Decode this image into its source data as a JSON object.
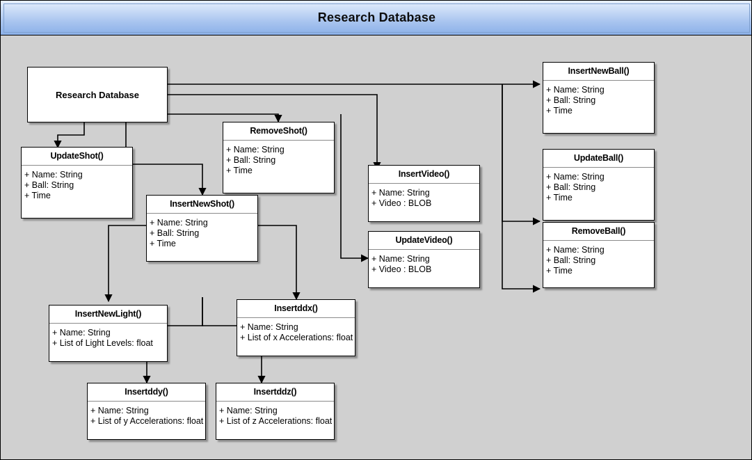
{
  "window": {
    "title": "Research Database"
  },
  "colors": {
    "background": "#d0d0d0",
    "titlebar_top": "#e8f0fc",
    "titlebar_bottom": "#8bb0e8",
    "box_fill": "#ffffff",
    "line": "#000000"
  },
  "diagram": {
    "root": {
      "label": "Research Database"
    },
    "nodes": [
      {
        "id": "update-shot",
        "title": "UpdateShot()",
        "attributes": [
          "+ Name: String",
          "+ Ball: String",
          "+ Time"
        ]
      },
      {
        "id": "remove-shot",
        "title": "RemoveShot()",
        "attributes": [
          "+ Name: String",
          "+ Ball: String",
          "+ Time"
        ]
      },
      {
        "id": "insert-new-shot",
        "title": "InsertNewShot()",
        "attributes": [
          "+ Name: String",
          "+ Ball: String",
          "+ Time"
        ]
      },
      {
        "id": "insert-video",
        "title": "InsertVideo()",
        "attributes": [
          "+ Name: String",
          "+ Video : BLOB"
        ]
      },
      {
        "id": "update-video",
        "title": "UpdateVideo()",
        "attributes": [
          "+ Name: String",
          "+ Video : BLOB"
        ]
      },
      {
        "id": "insert-new-ball",
        "title": "InsertNewBall()",
        "attributes": [
          "+ Name: String",
          "+ Ball: String",
          "+ Time"
        ]
      },
      {
        "id": "update-ball",
        "title": "UpdateBall()",
        "attributes": [
          "+ Name: String",
          "+ Ball: String",
          "+ Time"
        ]
      },
      {
        "id": "remove-ball",
        "title": "RemoveBall()",
        "attributes": [
          "+ Name: String",
          "+ Ball: String",
          "+ Time"
        ]
      },
      {
        "id": "insert-new-light",
        "title": "InsertNewLight()",
        "attributes": [
          "+ Name: String",
          "+ List of Light Levels: float"
        ]
      },
      {
        "id": "insert-ddx",
        "title": "Insertddx()",
        "attributes": [
          "+ Name: String",
          "+ List of x Accelerations: float"
        ]
      },
      {
        "id": "insert-ddy",
        "title": "Insertddy()",
        "attributes": [
          "+ Name: String",
          "+ List of y Accelerations: float"
        ]
      },
      {
        "id": "insert-ddz",
        "title": "Insertddz()",
        "attributes": [
          "+ Name: String",
          "+ List of z Accelerations: float"
        ]
      }
    ]
  }
}
